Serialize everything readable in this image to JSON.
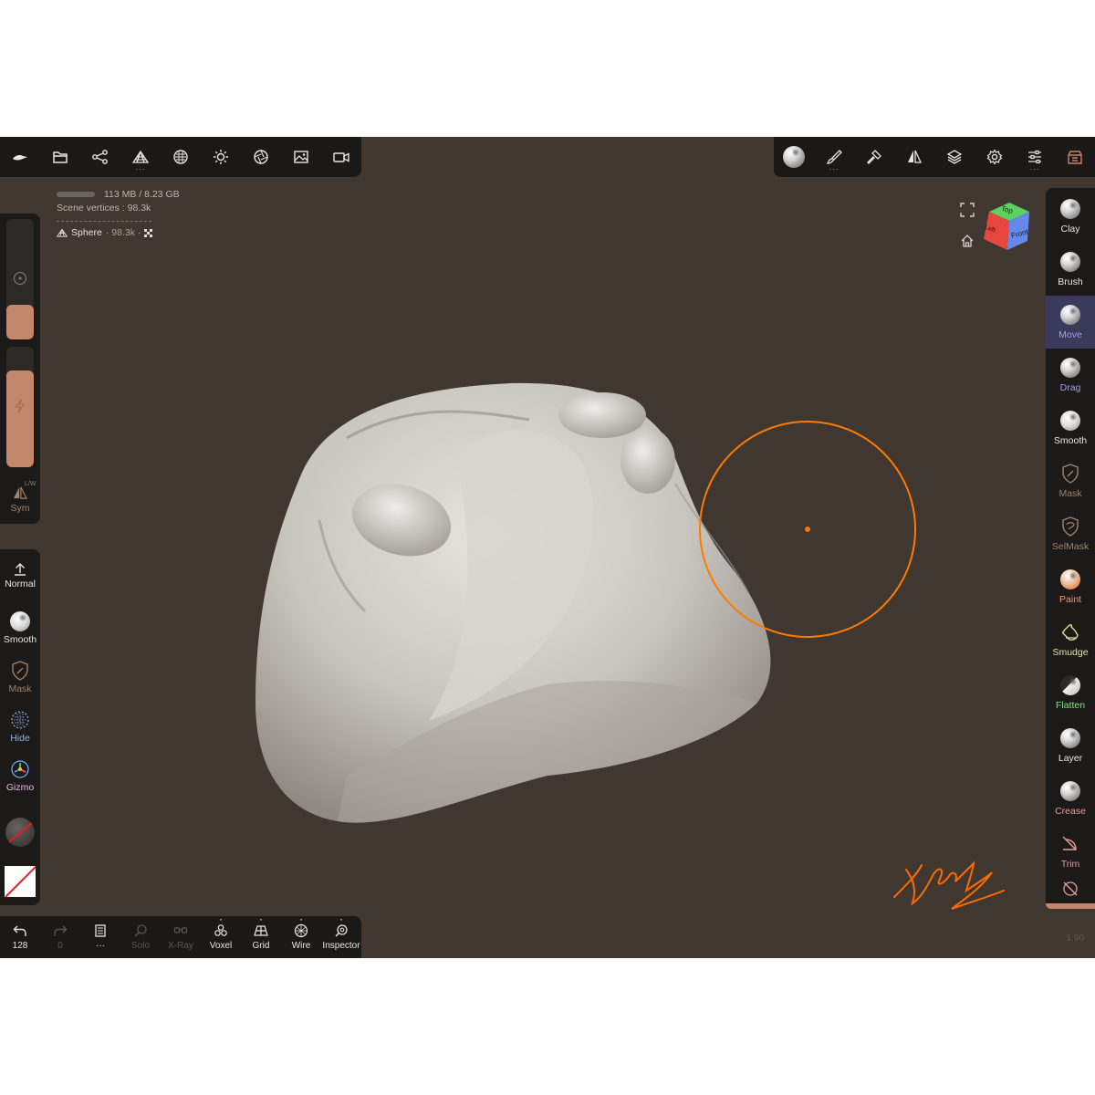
{
  "topbar_left": {
    "icons": [
      "logo-icon",
      "folder-icon",
      "scene-tree-icon",
      "mesh-topology-icon",
      "material-sphere-icon",
      "light-sun-icon",
      "camera-aperture-icon",
      "background-image-icon",
      "video-camera-icon"
    ]
  },
  "topbar_right": {
    "icons": [
      "material-ball-icon",
      "brush-stroke-icon",
      "hammer-icon",
      "symmetry-icon",
      "layers-icon",
      "settings-gear-icon",
      "sliders-icon",
      "tool-shop-icon"
    ]
  },
  "info": {
    "memory": "113 MB / 8.23 GB",
    "vertices_label": "Scene vertices :",
    "vertices_value": "98.3k",
    "object_name": "Sphere",
    "object_verts": "· 98.3k ·"
  },
  "sliders": {
    "radius_fill": 0.29,
    "intensity_fill": 0.8,
    "fill_color": "#c4876a",
    "sym_superscript": "L/W",
    "sym_label": "Sym"
  },
  "left_tools": {
    "normal": "Normal",
    "smooth": "Smooth",
    "mask": "Mask",
    "hide": "Hide",
    "gizmo": "Gizmo"
  },
  "bottombar": {
    "undo_count": "128",
    "redo_count": "0",
    "items": [
      {
        "name": "Solo",
        "enabled": false
      },
      {
        "name": "X-Ray",
        "enabled": false
      },
      {
        "name": "Voxel",
        "enabled": true
      },
      {
        "name": "Grid",
        "enabled": true
      },
      {
        "name": "Wire",
        "enabled": true
      },
      {
        "name": "Inspector",
        "enabled": true
      }
    ]
  },
  "right_tools": [
    {
      "name": "Clay",
      "color": "#e8e6e3"
    },
    {
      "name": "Brush",
      "color": "#e8e6e3"
    },
    {
      "name": "Move",
      "color": "#9f9fe6",
      "active": true
    },
    {
      "name": "Drag",
      "color": "#9f9fe6"
    },
    {
      "name": "Smooth",
      "color": "#e8e6e3"
    },
    {
      "name": "Mask",
      "color": "#a0836a"
    },
    {
      "name": "SelMask",
      "color": "#a0836a"
    },
    {
      "name": "Paint",
      "color": "#ec9a7a"
    },
    {
      "name": "Smudge",
      "color": "#e6e39a"
    },
    {
      "name": "Flatten",
      "color": "#86e08e"
    },
    {
      "name": "Layer",
      "color": "#e8e6e3"
    },
    {
      "name": "Crease",
      "color": "#ec9a9a"
    },
    {
      "name": "Trim",
      "color": "#ec9a9a"
    }
  ],
  "zoom": "1.90",
  "viewcube": {
    "top": "Top",
    "front": "Front",
    "left": "Left"
  },
  "brush_cursor_color": "#ff7a00",
  "accent_color": "#c4876a"
}
